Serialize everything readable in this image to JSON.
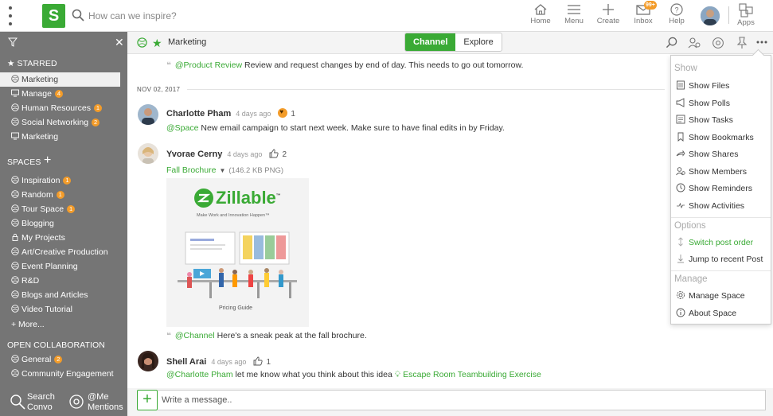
{
  "header": {
    "logo_letter": "S",
    "search_placeholder": "How can we inspire?",
    "nav": {
      "home": "Home",
      "menu": "Menu",
      "create": "Create",
      "inbox": "Inbox",
      "inbox_badge": "99+",
      "help": "Help",
      "apps": "Apps"
    }
  },
  "sidebar": {
    "starred_title": "STARRED",
    "starred": [
      {
        "label": "Marketing",
        "badge": ""
      },
      {
        "label": "Manage",
        "badge": "4"
      },
      {
        "label": "Human Resources",
        "badge": "1"
      },
      {
        "label": "Social Networking",
        "badge": "2"
      },
      {
        "label": "Marketing",
        "badge": ""
      }
    ],
    "spaces_title": "SPACES",
    "spaces": [
      {
        "label": "Inspiration",
        "badge": "1"
      },
      {
        "label": "Random",
        "badge": "1"
      },
      {
        "label": "Tour Space",
        "badge": "1"
      },
      {
        "label": "Blogging",
        "badge": ""
      },
      {
        "label": "My Projects",
        "badge": ""
      },
      {
        "label": "Art/Creative Production",
        "badge": ""
      },
      {
        "label": "Event Planning",
        "badge": ""
      },
      {
        "label": "R&D",
        "badge": ""
      },
      {
        "label": "Blogs and Articles",
        "badge": ""
      },
      {
        "label": "Video Tutorial",
        "badge": ""
      }
    ],
    "more": "+ More...",
    "open_title": "OPEN COLLABORATION",
    "open": [
      {
        "label": "General",
        "badge": "2"
      },
      {
        "label": "Community Engagement",
        "badge": ""
      }
    ],
    "bottom": {
      "search_line1": "Search",
      "search_line2": "Convo",
      "mentions_line1": "@Me",
      "mentions_line2": "Mentions"
    }
  },
  "main": {
    "space_title": "Marketing",
    "tabs": {
      "channel": "Channel",
      "explore": "Explore"
    },
    "date": "NOV 02, 2017",
    "posts": {
      "first": {
        "mention": "@Product Review",
        "text": " Review and request changes by end of day.  This needs to go out tomorrow."
      },
      "charlotte": {
        "name": "Charlotte Pham",
        "time": "4 days ago",
        "reaction": "1",
        "mention": "@Space",
        "text": " New email campaign to start next week.  Make sure to have final edits in by Friday."
      },
      "yvorae": {
        "name": "Yvorae Cerny",
        "time": "4 days ago",
        "reaction": "2",
        "file": "Fall Brochure",
        "size": "(146.2 KB PNG)",
        "thumb_brand": "Zillable",
        "thumb_tm": "™",
        "thumb_tagline": "Make Work and Innovation Happen™",
        "thumb_caption": "Pricing Guide",
        "mention": "@Channel",
        "text": " Here's a sneak peak at the fall brochure."
      },
      "shell": {
        "name": "Shell Arai",
        "time": "4 days ago",
        "reaction": "1",
        "mention": "@Charlotte Pham",
        "text": " let me know what you think about this idea ",
        "link": "Escape Room Teambuilding Exercise"
      }
    },
    "composer_placeholder": "Write a message.."
  },
  "dropdown": {
    "show_title": "Show",
    "show": [
      "Show Files",
      "Show Polls",
      "Show Tasks",
      "Show Bookmarks",
      "Show Shares",
      "Show Members",
      "Show Reminders",
      "Show Activities"
    ],
    "options_title": "Options",
    "options": [
      "Switch post order",
      "Jump to recent Post"
    ],
    "manage_title": "Manage",
    "manage": [
      "Manage Space",
      "About Space"
    ]
  },
  "colors": {
    "brand": "#3aaa35",
    "badge": "#f39c2a",
    "sidebar": "#757575"
  }
}
